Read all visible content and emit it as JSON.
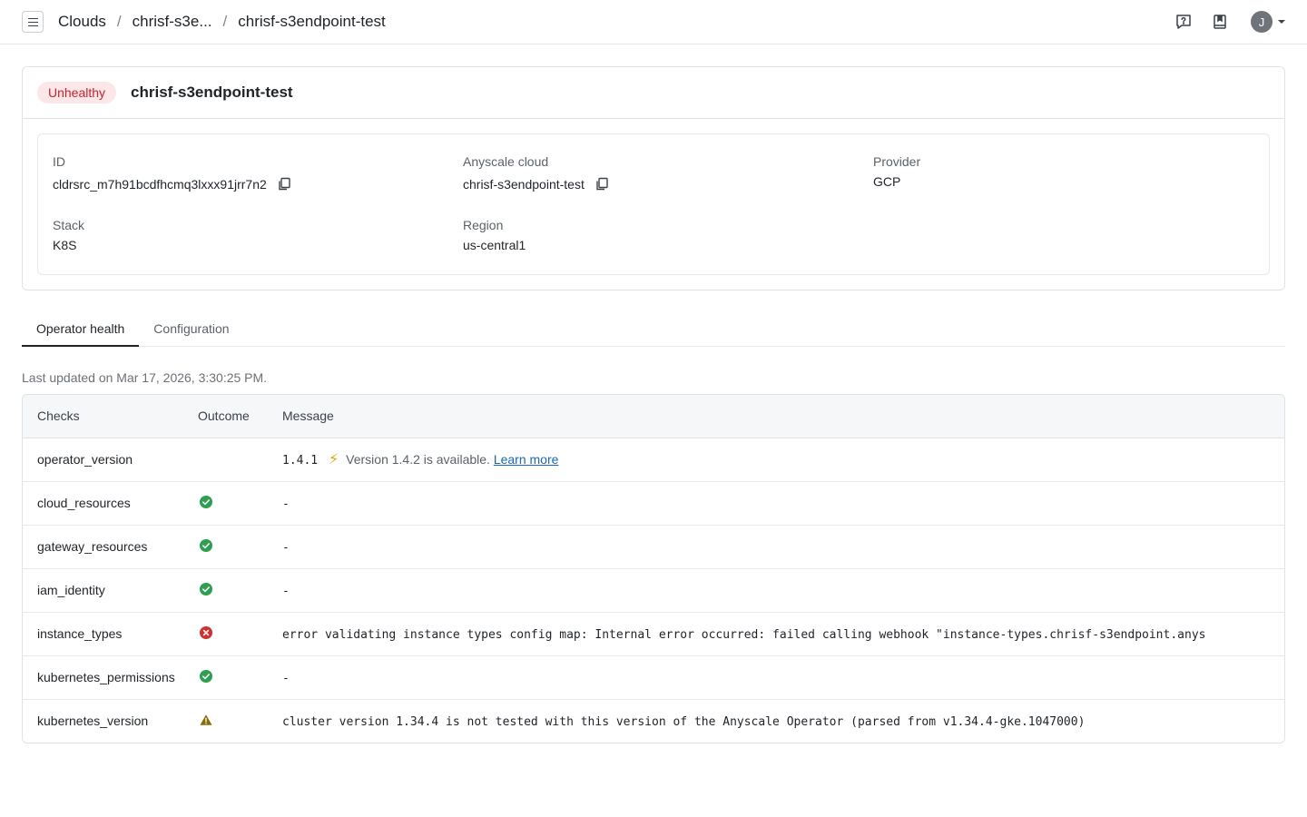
{
  "breadcrumb": {
    "root": "Clouds",
    "middle": "chrisf-s3e...",
    "current": "chrisf-s3endpoint-test"
  },
  "header_icons": [
    "help-icon",
    "docs-icon"
  ],
  "user": {
    "initial": "J"
  },
  "cloud": {
    "status": "Unhealthy",
    "name": "chrisf-s3endpoint-test",
    "fields": {
      "id_label": "ID",
      "id_value": "cldrsrc_m7h91bcdfhcmq3lxxx91jrr7n2",
      "anyscale_label": "Anyscale cloud",
      "anyscale_value": "chrisf-s3endpoint-test",
      "provider_label": "Provider",
      "provider_value": "GCP",
      "stack_label": "Stack",
      "stack_value": "K8S",
      "region_label": "Region",
      "region_value": "us-central1"
    }
  },
  "tabs": [
    {
      "label": "Operator health",
      "active": true
    },
    {
      "label": "Configuration",
      "active": false
    }
  ],
  "last_updated": "Last updated on Mar 17, 2026, 3:30:25 PM.",
  "table": {
    "headers": {
      "checks": "Checks",
      "outcome": "Outcome",
      "message": "Message"
    },
    "rows": [
      {
        "check": "operator_version",
        "outcome": "none",
        "message": "1.4.1",
        "note": "Version 1.4.2 is available.",
        "link": "Learn more"
      },
      {
        "check": "cloud_resources",
        "outcome": "success",
        "message": "-"
      },
      {
        "check": "gateway_resources",
        "outcome": "success",
        "message": "-"
      },
      {
        "check": "iam_identity",
        "outcome": "success",
        "message": "-"
      },
      {
        "check": "instance_types",
        "outcome": "error",
        "message": "error validating instance types config map: Internal error occurred: failed calling webhook \"instance-types.chrisf-s3endpoint.anys"
      },
      {
        "check": "kubernetes_permissions",
        "outcome": "success",
        "message": "-"
      },
      {
        "check": "kubernetes_version",
        "outcome": "warning",
        "message": "cluster version 1.34.4 is not tested with this version of the Anyscale Operator (parsed from v1.34.4-gke.1047000)"
      }
    ]
  },
  "colors": {
    "success": "#2e9e4f",
    "error": "#d32f2f",
    "warning": "#8a6d00",
    "link": "#1a66c2",
    "unhealthy_bg": "#fbe7e8",
    "unhealthy_text": "#c8222c"
  }
}
